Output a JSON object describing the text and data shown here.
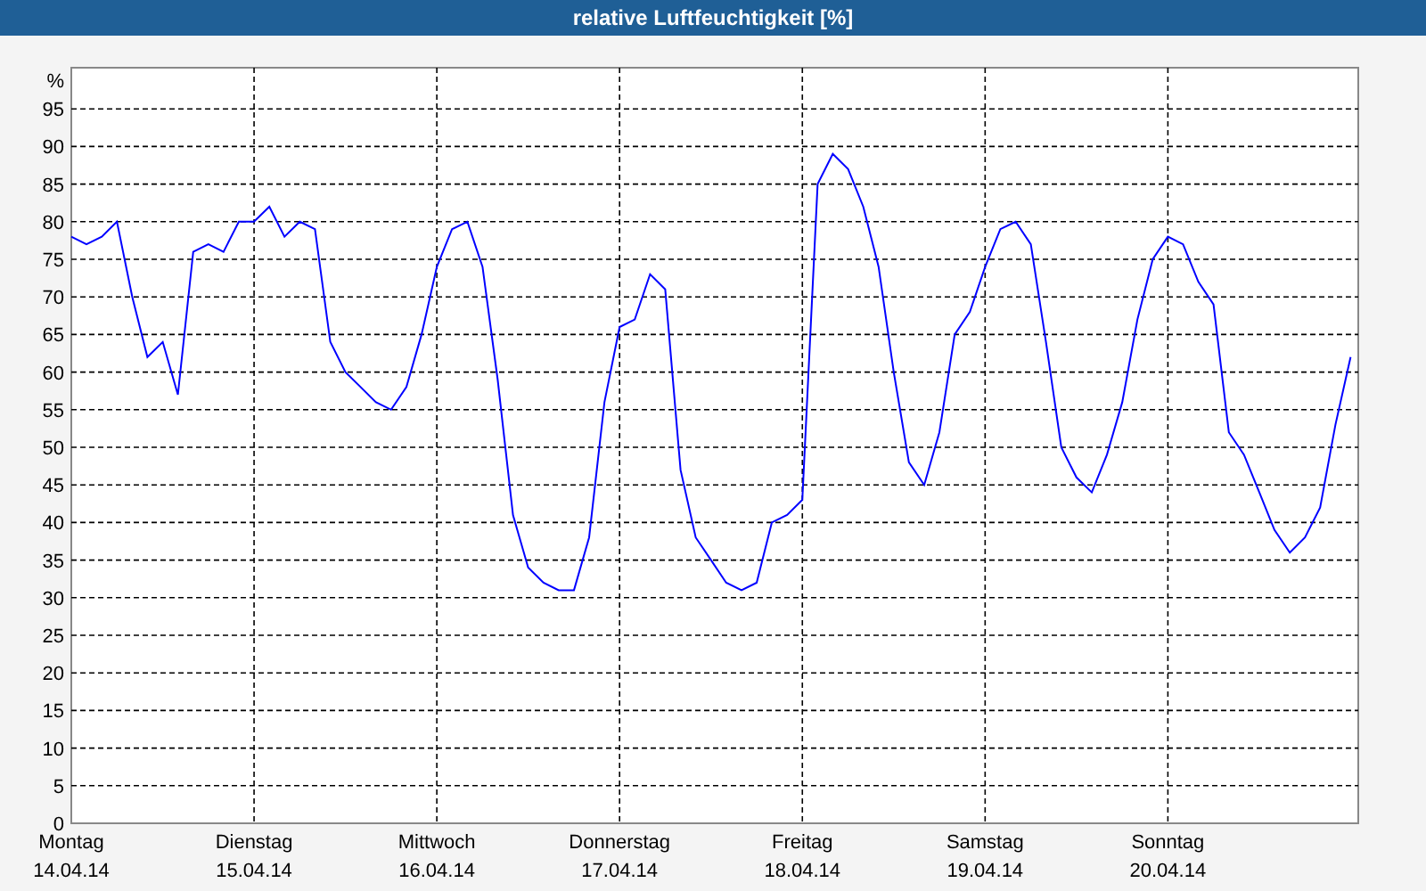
{
  "title": "relative Luftfeuchtigkeit [%]",
  "chart": {
    "chart_data": {
      "type": "line",
      "ylabel": "%",
      "ylim": [
        0,
        100
      ],
      "grid": true,
      "yticks": [
        0,
        5,
        10,
        15,
        20,
        25,
        30,
        35,
        40,
        45,
        50,
        55,
        60,
        65,
        70,
        75,
        80,
        85,
        90,
        95
      ],
      "categories": [
        "Montag\n14.04.14",
        null,
        null,
        null,
        null,
        null,
        null,
        null,
        null,
        null,
        null,
        null,
        "Dienstag\n15.04.14",
        null,
        null,
        null,
        null,
        null,
        null,
        null,
        null,
        null,
        null,
        null,
        "Mittwoch\n16.04.14",
        null,
        null,
        null,
        null,
        null,
        null,
        null,
        null,
        null,
        null,
        null,
        "Donnerstag\n17.04.14",
        null,
        null,
        null,
        null,
        null,
        null,
        null,
        null,
        null,
        null,
        null,
        "Freitag\n18.04.14",
        null,
        null,
        null,
        null,
        null,
        null,
        null,
        null,
        null,
        null,
        null,
        "Samstag\n19.04.14",
        null,
        null,
        null,
        null,
        null,
        null,
        null,
        null,
        null,
        null,
        null,
        "Sonntag\n20.04.14",
        null,
        null,
        null,
        null,
        null,
        null,
        null,
        null,
        null,
        null,
        null,
        null
      ],
      "series": [
        {
          "color": "#0000ff",
          "values": [
            78,
            77,
            78,
            80,
            70,
            62,
            64,
            57,
            76,
            77,
            76,
            80,
            80,
            82,
            78,
            80,
            79,
            64,
            60,
            58,
            56,
            55,
            58,
            65,
            74,
            79,
            80,
            74,
            59,
            41,
            34,
            32,
            31,
            31,
            38,
            56,
            66,
            67,
            73,
            71,
            47,
            38,
            35,
            32,
            31,
            32,
            40,
            41,
            43,
            85,
            89,
            87,
            82,
            74,
            60,
            48,
            45,
            52,
            65,
            68,
            74,
            79,
            80,
            77,
            64,
            50,
            46,
            44,
            49,
            56,
            67,
            75,
            78,
            77,
            72,
            69,
            52,
            49,
            44,
            39,
            36,
            38,
            42,
            53,
            62
          ]
        }
      ]
    }
  }
}
